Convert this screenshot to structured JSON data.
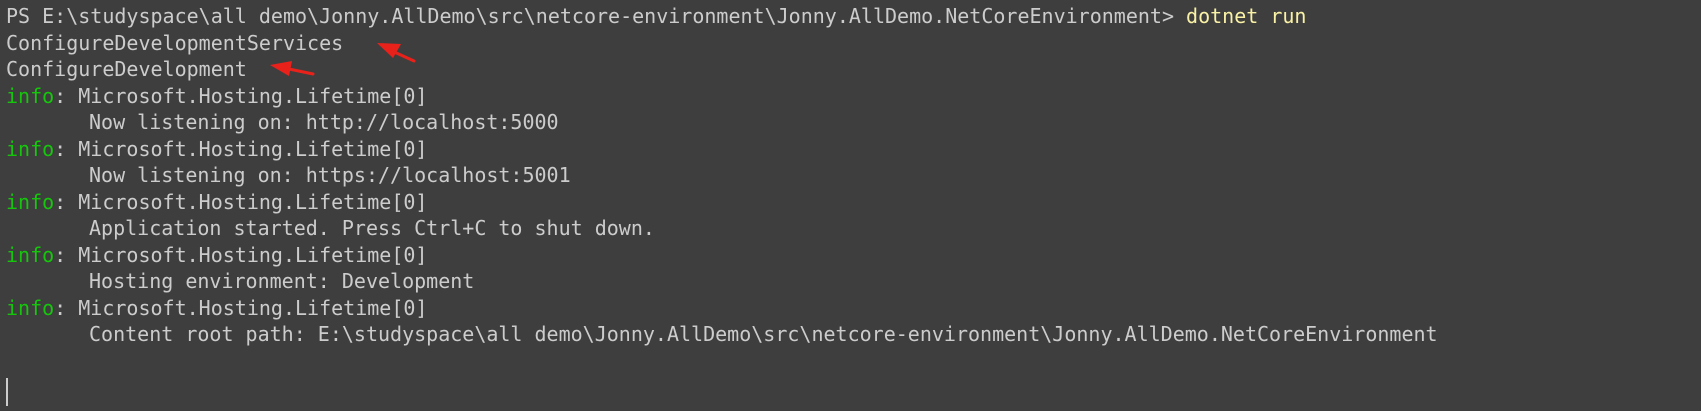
{
  "terminal": {
    "prompt": "PS E:\\studyspace\\all demo\\Jonny.AllDemo\\src\\netcore-environment\\Jonny.AllDemo.NetCoreEnvironment> ",
    "command": "dotnet run",
    "output": [
      "ConfigureDevelopmentServices",
      "ConfigureDevelopment"
    ],
    "logs": [
      {
        "level": "info",
        "source": ": Microsoft.Hosting.Lifetime[0]",
        "message": "Now listening on: http://localhost:5000"
      },
      {
        "level": "info",
        "source": ": Microsoft.Hosting.Lifetime[0]",
        "message": "Now listening on: https://localhost:5001"
      },
      {
        "level": "info",
        "source": ": Microsoft.Hosting.Lifetime[0]",
        "message": "Application started. Press Ctrl+C to shut down."
      },
      {
        "level": "info",
        "source": ": Microsoft.Hosting.Lifetime[0]",
        "message": "Hosting environment: Development"
      },
      {
        "level": "info",
        "source": ": Microsoft.Hosting.Lifetime[0]",
        "message": "Content root path: E:\\studyspace\\all demo\\Jonny.AllDemo\\src\\netcore-environment\\Jonny.AllDemo.NetCoreEnvironment"
      }
    ]
  },
  "colors": {
    "background": "#3e3e3e",
    "text": "#cccccc",
    "log_level": "#16c60c",
    "command": "#f9f1a5",
    "annotation_arrow": "#e8221b"
  }
}
